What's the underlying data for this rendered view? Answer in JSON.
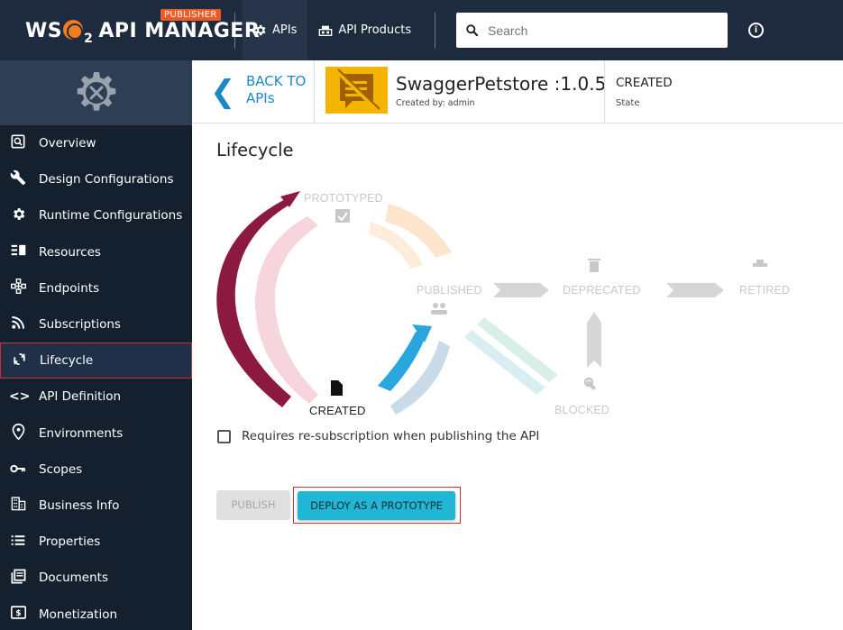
{
  "topbar": {
    "brand_text": "WSO2 API MANAGER",
    "brand_badge": "PUBLISHER",
    "nav": [
      {
        "label": "APIs",
        "icon": "gear-icon"
      },
      {
        "label": "API Products",
        "icon": "products-icon"
      }
    ],
    "search_placeholder": "Search"
  },
  "sidebar": {
    "items": [
      {
        "label": "Overview",
        "icon": "overview-icon",
        "active": false
      },
      {
        "label": "Design Configurations",
        "icon": "wrench-icon",
        "active": false
      },
      {
        "label": "Runtime Configurations",
        "icon": "gear-icon",
        "active": false
      },
      {
        "label": "Resources",
        "icon": "resources-icon",
        "active": false
      },
      {
        "label": "Endpoints",
        "icon": "endpoints-icon",
        "active": false
      },
      {
        "label": "Subscriptions",
        "icon": "rss-icon",
        "active": false
      },
      {
        "label": "Lifecycle",
        "icon": "cycle-icon",
        "active": true
      },
      {
        "label": "API Definition",
        "icon": "code-icon",
        "active": false
      },
      {
        "label": "Environments",
        "icon": "location-icon",
        "active": false
      },
      {
        "label": "Scopes",
        "icon": "key-icon",
        "active": false
      },
      {
        "label": "Business Info",
        "icon": "building-icon",
        "active": false
      },
      {
        "label": "Properties",
        "icon": "list-icon",
        "active": false
      },
      {
        "label": "Documents",
        "icon": "documents-icon",
        "active": false
      },
      {
        "label": "Monetization",
        "icon": "money-icon",
        "active": false
      }
    ]
  },
  "header": {
    "back_line1": "BACK TO",
    "back_line2": "APIs",
    "api_name": "SwaggerPetstore :1.0.5",
    "created_by": "Created by: admin",
    "state_value": "CREATED",
    "state_label": "State"
  },
  "main": {
    "title": "Lifecycle",
    "stages": {
      "prototyped": "PROTOTYPED",
      "published": "PUBLISHED",
      "deprecated": "DEPRECATED",
      "retired": "RETIRED",
      "created": "CREATED",
      "blocked": "BLOCKED"
    },
    "checkbox_label": "Requires re-subscription when publishing the API",
    "checkbox_checked": false,
    "publish_label": "PUBLISH",
    "deploy_label": "DEPLOY AS A PROTOTYPE"
  },
  "colors": {
    "topbar": "#1e2a3d",
    "sidebar": "#15202f",
    "accent": "#1e88c7",
    "deploy_button": "#1fb7d4",
    "created_arc": "#8c1940"
  }
}
